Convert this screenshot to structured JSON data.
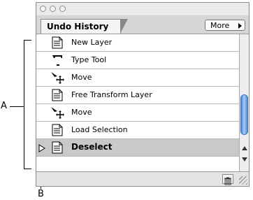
{
  "panel": {
    "tab_label": "Undo History",
    "more_label": "More"
  },
  "history": [
    {
      "label": "New Layer",
      "icon": "document-icon",
      "selected": false
    },
    {
      "label": "Type Tool",
      "icon": "type-tool-icon",
      "selected": false
    },
    {
      "label": "Move",
      "icon": "move-tool-icon",
      "selected": false
    },
    {
      "label": "Free Transform Layer",
      "icon": "document-icon",
      "selected": false
    },
    {
      "label": "Move",
      "icon": "move-tool-icon",
      "selected": false
    },
    {
      "label": "Load Selection",
      "icon": "document-icon",
      "selected": false
    },
    {
      "label": "Deselect",
      "icon": "document-icon",
      "selected": true
    }
  ],
  "callouts": {
    "a": "A",
    "b": "B"
  },
  "colors": {
    "scroll_thumb": "#4a86d8",
    "selected_row": "#c9c9c9"
  }
}
